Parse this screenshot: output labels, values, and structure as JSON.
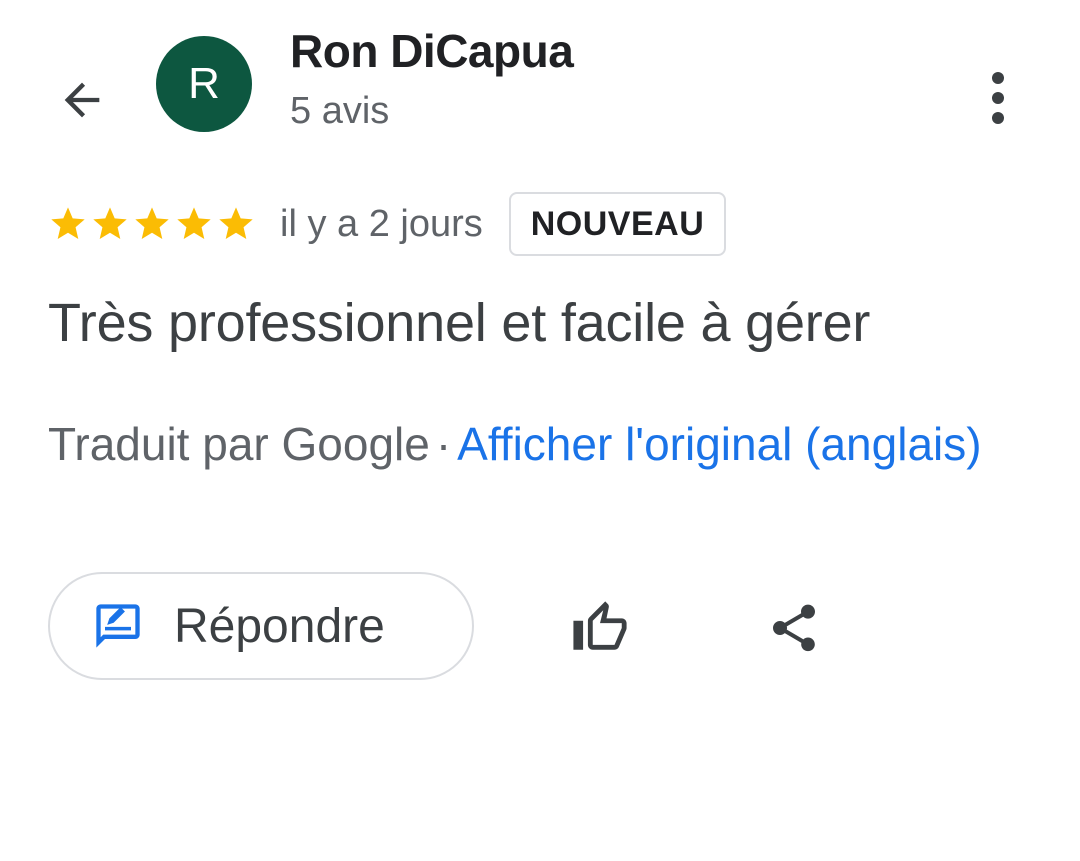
{
  "header": {
    "avatar_initial": "R",
    "avatar_color": "#0d5740",
    "user_name": "Ron DiCapua",
    "review_count": "5 avis",
    "back_icon": "arrow-left-icon",
    "more_icon": "more-vertical-icon"
  },
  "review": {
    "rating": 5,
    "rating_max": 5,
    "star_color": "#fbbc04",
    "time_ago": "il y a 2 jours",
    "badge": "NOUVEAU",
    "text": "Très professionnel et facile à gérer",
    "translated_by": "Traduit par Google",
    "separator": "·",
    "show_original": "Afficher l'original (anglais)",
    "link_color": "#1a73e8"
  },
  "actions": {
    "reply_label": "Répondre",
    "reply_icon": "reply-comment-icon",
    "like_icon": "thumbs-up-icon",
    "share_icon": "share-icon"
  }
}
